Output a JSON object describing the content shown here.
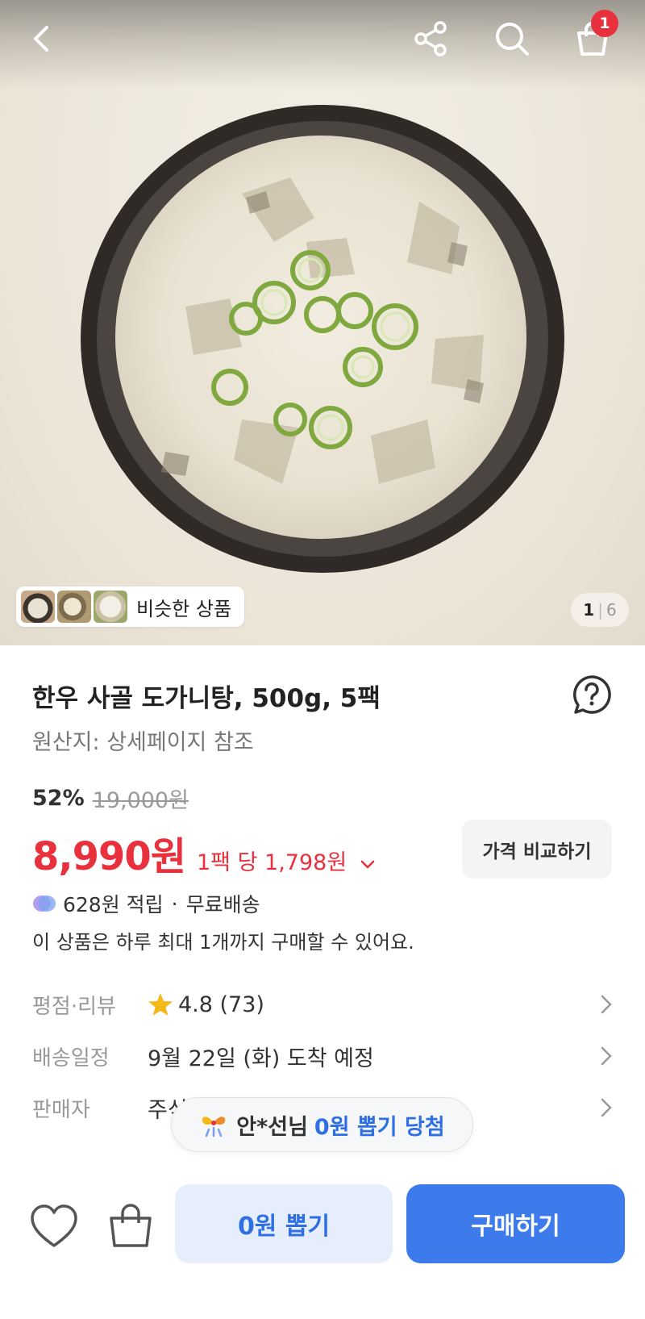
{
  "header": {
    "back_icon": "chevron-left-icon",
    "share_icon": "share-icon",
    "search_icon": "search-icon",
    "cart_icon": "cart-icon",
    "cart_badge": "1",
    "badge_color": "#e8313d"
  },
  "gallery": {
    "similar_label": "비슷한 상품",
    "current_page": "1",
    "separator": "|",
    "total_pages": "6"
  },
  "product": {
    "title": "한우 사골 도가니탕, 500g, 5팩",
    "origin": "원산지: 상세페이지 참조",
    "discount": "52%",
    "original_price": "19,000원",
    "price": "8,990원",
    "unit_price": "1팩 당 1,798원",
    "compare_button": "가격 비교하기",
    "points": "628원 적립",
    "points_dot": "·",
    "shipping": "무료배송",
    "purchase_limit": "이 상품은 하루 최대 1개까지 구매할 수 있어요.",
    "price_color": "#e8313d"
  },
  "details": [
    {
      "label": "평점·리뷰",
      "value": "4.8 (73)"
    },
    {
      "label": "배송일정",
      "value": "9월 22일 (화) 도착 예정"
    },
    {
      "label": "판매자",
      "value": "주식"
    }
  ],
  "rating": 4.8,
  "winner_toast": {
    "name": "안*선님",
    "highlight": "0원 뽑기 당첨"
  },
  "bottom_bar": {
    "heart_icon": "heart-icon",
    "bag_icon": "shopping-bag-icon",
    "draw_button": "0원 뽑기",
    "buy_button": "구매하기",
    "accent": "#3d7bed"
  }
}
